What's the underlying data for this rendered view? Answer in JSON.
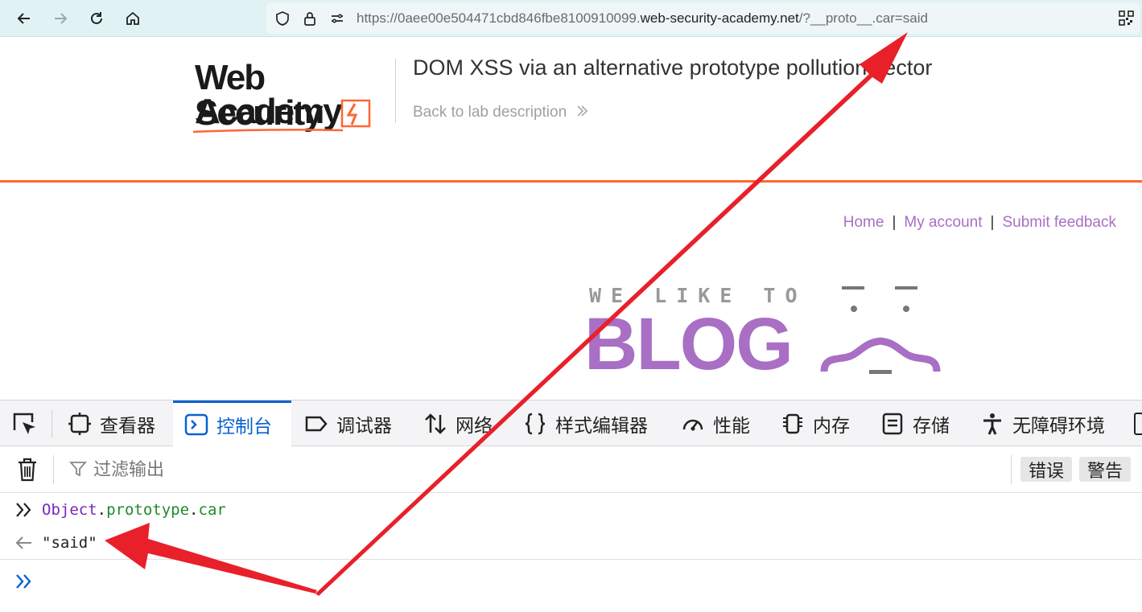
{
  "browser": {
    "url_prefix": "https://0aee00e504471cbd846fbe8100910099.",
    "url_host": "web-security-academy.net",
    "url_suffix": "/?__proto__.car=said"
  },
  "lab": {
    "logo_line1": "Web Security",
    "logo_line2": "Academy",
    "title": "DOM XSS via an alternative prototype pollution vector",
    "back_link": "Back to lab description",
    "back_link_icon": "double-chevron-right-icon"
  },
  "nav": {
    "home": "Home",
    "separator": "|",
    "my_account": "My account",
    "submit_feedback": "Submit feedback"
  },
  "banner": {
    "small_text": "WE LIKE TO",
    "big_text": "BLOG"
  },
  "devtools": {
    "tabs": [
      {
        "label": "查看器",
        "icon": "inspector-icon"
      },
      {
        "label": "控制台",
        "icon": "console-icon"
      },
      {
        "label": "调试器",
        "icon": "debugger-icon"
      },
      {
        "label": "网络",
        "icon": "network-icon"
      },
      {
        "label": "样式编辑器",
        "icon": "style-editor-icon"
      },
      {
        "label": "性能",
        "icon": "performance-icon"
      },
      {
        "label": "内存",
        "icon": "memory-icon"
      },
      {
        "label": "存储",
        "icon": "storage-icon"
      },
      {
        "label": "无障碍环境",
        "icon": "accessibility-icon"
      }
    ],
    "active_tab": "控制台",
    "filter_placeholder": "过滤输出",
    "levels": [
      "错误",
      "警告"
    ],
    "console": {
      "input_object": "Object",
      "input_dot1": ".",
      "input_prop1": "prototype",
      "input_dot2": ".",
      "input_prop2": "car",
      "result": "\"said\""
    }
  },
  "colors": {
    "accent_orange": "#ff6633",
    "link_purple": "#a86fc4",
    "devtools_blue": "#0a62d0",
    "arrow_red": "#e8202a"
  }
}
